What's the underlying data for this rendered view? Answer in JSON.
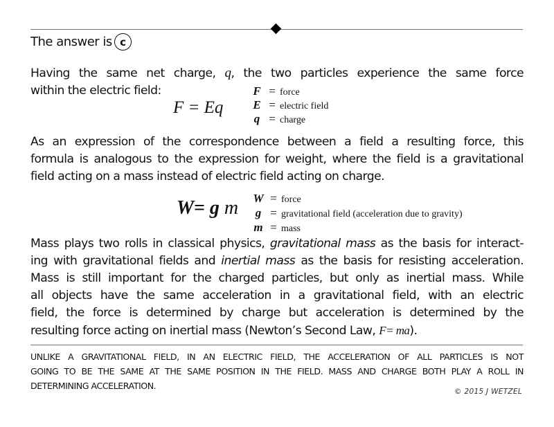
{
  "header": {
    "answer_prefix": "The answer is",
    "answer_letter": "c"
  },
  "para1": {
    "line1_a": "Having the same net charge, ",
    "line1_var": "q",
    "line1_b": ", the two particles experience the same force",
    "line2": "within the electric field:"
  },
  "formula1": {
    "expression": "F = Eq",
    "legend": [
      {
        "symbol": "F",
        "eq": "=",
        "desc": "force"
      },
      {
        "symbol": "E",
        "eq": "=",
        "desc": "electric field"
      },
      {
        "symbol": "q",
        "eq": "=",
        "desc": "charge"
      }
    ]
  },
  "para2": {
    "lines": [
      "As an expression of the correspondence between a field a resulting force, this",
      "formula is analogous to the expression for weight, where the field is a gravitational",
      "field acting on a mass instead of electric field acting on charge."
    ]
  },
  "formula2": {
    "lhs": "W= g",
    "rhs": " m",
    "legend": [
      {
        "symbol": "W",
        "eq": "=",
        "desc": "force"
      },
      {
        "symbol": "g",
        "eq": "=",
        "desc": "gravitational field (acceleration due to gravity)"
      },
      {
        "symbol": "m",
        "eq": "=",
        "desc": "mass"
      }
    ]
  },
  "para3": {
    "l1_a": "Mass plays two rolls in classical physics, ",
    "l1_em": "gravitational mass",
    "l1_b": " as the basis for interact-",
    "l2_a": "ing with gravitational fields and ",
    "l2_em": "inertial mass",
    "l2_b": " as the basis for resisting acceleration.",
    "l3": "Mass is still important for the charged particles, but only as inertial mass.  While",
    "l4": "all objects have the same acceleration in a gravitational field, with an electric",
    "l5": "field, the force is determined by charge but acceleration is determined by the",
    "l6_a": "resulting force acting on inertial mass (Newton’s Second Law, ",
    "l6_formula": "F= ma",
    "l6_b": ")."
  },
  "caption": {
    "lines": [
      "UNLIKE A GRAVITATIONAL FIELD, IN AN ELECTRIC FIELD, THE ACCELERATION OF ALL PARTICLES IS NOT",
      "GOING TO BE THE SAME AT THE SAME POSITION IN THE FIELD.  MASS AND CHARGE BOTH PLAY A ROLL IN",
      "DETERMINING ACCELERATION."
    ]
  },
  "copyright": "© 2015 J WETZEL"
}
